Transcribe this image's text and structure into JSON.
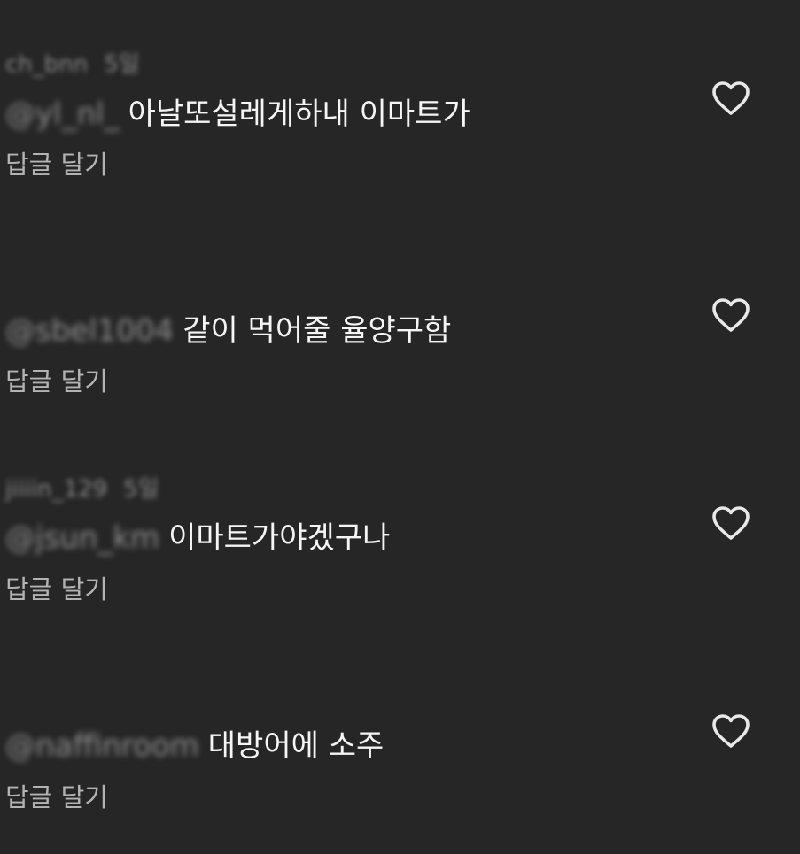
{
  "comments": [
    {
      "author": "ch_bnn",
      "time": "5일",
      "mention": "@yl_nl_",
      "text": "아날또설레게하내 이마트가",
      "reply_label": "답글 달기",
      "like_icon": "heart-outline-icon"
    },
    {
      "author": "",
      "time": "",
      "mention": "@sbel1004",
      "text": "같이 먹어줄 율양구함",
      "reply_label": "답글 달기",
      "like_icon": "heart-outline-icon"
    },
    {
      "author": "jiiiin_129",
      "time": "5일",
      "mention": "@jsun_km",
      "text": "이마트가야겠구나",
      "reply_label": "답글 달기",
      "like_icon": "heart-outline-icon"
    },
    {
      "author": "",
      "time": "",
      "mention": "@naffinroom",
      "text": "대방어에 소주",
      "reply_label": "답글 달기",
      "like_icon": "heart-outline-icon"
    }
  ],
  "colors": {
    "background": "#262626",
    "text": "#f5f5f5",
    "secondary_text": "#b3b3b3",
    "icon": "#e8e8e8"
  }
}
